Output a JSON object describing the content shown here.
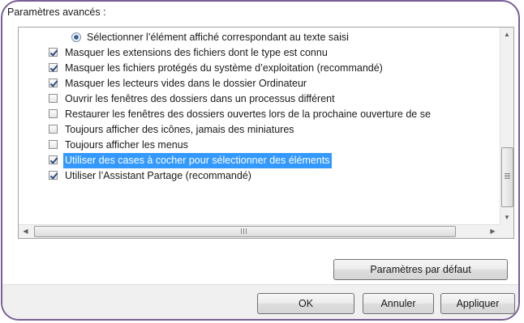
{
  "section_label": "Paramètres avancés :",
  "items": [
    {
      "type": "radio",
      "checked": true,
      "label": "Sélectionner l’élément affiché correspondant au texte saisi",
      "selected": false
    },
    {
      "type": "checkbox",
      "checked": true,
      "label": "Masquer les extensions des fichiers dont le type est connu",
      "selected": false
    },
    {
      "type": "checkbox",
      "checked": true,
      "label": "Masquer les fichiers protégés du système d’exploitation (recommandé)",
      "selected": false
    },
    {
      "type": "checkbox",
      "checked": true,
      "label": "Masquer les lecteurs vides dans le dossier Ordinateur",
      "selected": false
    },
    {
      "type": "checkbox",
      "checked": false,
      "label": "Ouvrir les fenêtres des dossiers dans un processus différent",
      "selected": false
    },
    {
      "type": "checkbox",
      "checked": false,
      "label": "Restaurer les fenêtres des dossiers ouvertes lors de la prochaine ouverture de se",
      "selected": false
    },
    {
      "type": "checkbox",
      "checked": false,
      "label": "Toujours afficher des icônes, jamais des miniatures",
      "selected": false
    },
    {
      "type": "checkbox",
      "checked": false,
      "label": "Toujours afficher les menus",
      "selected": false
    },
    {
      "type": "checkbox",
      "checked": true,
      "label": "Utiliser des cases à cocher pour sélectionner des éléments",
      "selected": true
    },
    {
      "type": "checkbox",
      "checked": true,
      "label": "Utiliser l’Assistant Partage (recommandé)",
      "selected": false
    }
  ],
  "scrollbar": {
    "up_icon": "scroll-up-arrow-icon",
    "down_icon": "scroll-down-arrow-icon",
    "left_icon": "scroll-left-arrow-icon",
    "right_icon": "scroll-right-arrow-icon",
    "h_grip": "III"
  },
  "buttons": {
    "restore_defaults": "Paramètres par défaut",
    "ok": "OK",
    "cancel": "Annuler",
    "apply": "Appliquer"
  },
  "colors": {
    "frame": "#7b5e96",
    "selection": "#3399ff"
  }
}
